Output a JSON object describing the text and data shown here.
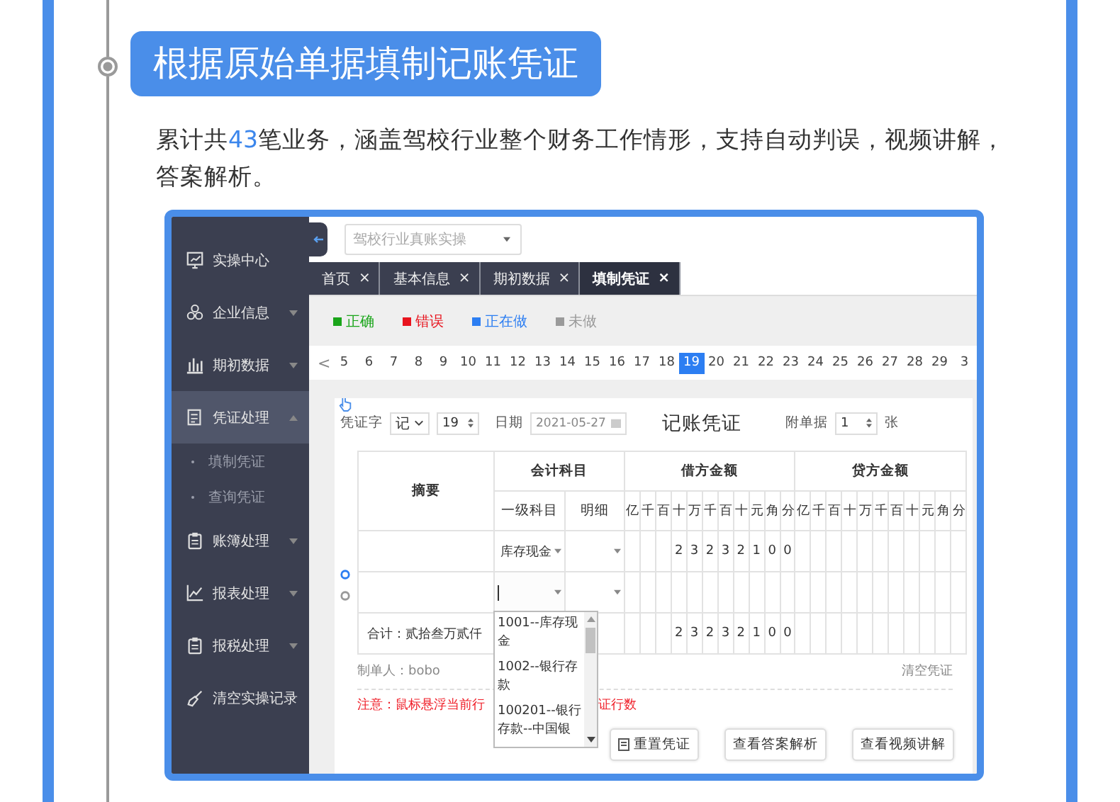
{
  "heading": "根据原始单据填制记账凭证",
  "intro": {
    "before": "累计共",
    "number": "43",
    "after": "笔业务，涵盖驾校行业整个财务工作情形，支持自动判误，视频讲解，答案解析。"
  },
  "app": {
    "sidebar": [
      {
        "label": "实操中心",
        "selected": false
      },
      {
        "label": "企业信息",
        "selected": false,
        "expanded": false
      },
      {
        "label": "期初数据",
        "selected": false,
        "expanded": false
      },
      {
        "label": "凭证处理",
        "selected": true,
        "expanded": true,
        "children": [
          {
            "label": "填制凭证",
            "selected": false
          },
          {
            "label": "查询凭证",
            "selected": false
          }
        ]
      },
      {
        "label": "账簿处理",
        "selected": false,
        "expanded": false
      },
      {
        "label": "报表处理",
        "selected": false,
        "expanded": false
      },
      {
        "label": "报税处理",
        "selected": false,
        "expanded": false
      },
      {
        "label": "清空实操记录",
        "selected": false
      }
    ],
    "company_select": {
      "placeholder": "驾校行业真账实操"
    },
    "tabs": [
      {
        "label": "首页",
        "close": "×",
        "selected": false
      },
      {
        "label": "基本信息",
        "close": "×",
        "selected": false
      },
      {
        "label": "期初数据",
        "close": "×",
        "selected": false
      },
      {
        "label": "填制凭证",
        "close": "×",
        "selected": true
      }
    ],
    "legend": [
      {
        "label": "正确",
        "color": "#1aa51a"
      },
      {
        "label": "错误",
        "color": "#e8141e"
      },
      {
        "label": "正在做",
        "color": "#2c7ef2"
      },
      {
        "label": "未做",
        "color": "#9a9a9a"
      }
    ],
    "pager": {
      "prev": "<",
      "pages": [
        {
          "label": "5",
          "selected": false
        },
        {
          "label": "6",
          "selected": false
        },
        {
          "label": "7",
          "selected": false
        },
        {
          "label": "8",
          "selected": false
        },
        {
          "label": "9",
          "selected": false
        },
        {
          "label": "10",
          "selected": false
        },
        {
          "label": "11",
          "selected": false
        },
        {
          "label": "12",
          "selected": false
        },
        {
          "label": "13",
          "selected": false
        },
        {
          "label": "14",
          "selected": false
        },
        {
          "label": "15",
          "selected": false
        },
        {
          "label": "16",
          "selected": false
        },
        {
          "label": "17",
          "selected": false
        },
        {
          "label": "18",
          "selected": false
        },
        {
          "label": "19",
          "selected": true
        },
        {
          "label": "20",
          "selected": false
        },
        {
          "label": "21",
          "selected": false
        },
        {
          "label": "22",
          "selected": false
        },
        {
          "label": "23",
          "selected": false
        },
        {
          "label": "24",
          "selected": false
        },
        {
          "label": "25",
          "selected": false
        },
        {
          "label": "26",
          "selected": false
        },
        {
          "label": "27",
          "selected": false
        },
        {
          "label": "28",
          "selected": false
        },
        {
          "label": "29",
          "selected": false
        },
        {
          "label": "3",
          "selected": false
        }
      ]
    },
    "voucher": {
      "word_label": "凭证字",
      "word": "记",
      "number": "19",
      "date_label": "日期",
      "date": "2021-05-27",
      "title": "记账凭证",
      "attach_label": "附单据",
      "attach": "1",
      "attach_unit": "张",
      "headers": {
        "summary": "摘要",
        "account": "会计科目",
        "level1": "一级科目",
        "detail": "明细",
        "debit": "借方金额",
        "credit": "贷方金额"
      },
      "debit_units": [
        "亿",
        "千",
        "百",
        "十",
        "万",
        "千",
        "百",
        "十",
        "元",
        "角",
        "分"
      ],
      "credit_units": [
        "亿",
        "千",
        "百",
        "十",
        "万",
        "千",
        "百",
        "十",
        "元",
        "角",
        "分"
      ],
      "rows": [
        {
          "account": "库存现金",
          "debit": [
            "2",
            "3",
            "2",
            "3",
            "2",
            "1",
            "0",
            "0"
          ],
          "editing": false
        },
        {
          "editing": true
        }
      ],
      "total": {
        "label": "合计：贰拾叁万贰仟",
        "debit": [
          "2",
          "3",
          "2",
          "3",
          "2",
          "1",
          "0",
          "0"
        ]
      },
      "maker": "制单人：bobo",
      "clear": "清空凭证",
      "note": [
        "注意：鼠标悬浮当前行",
        "证行数"
      ],
      "dropdown": [
        "1001--库存现金",
        "1002--银行存款",
        "100201--银行存款--中国银"
      ],
      "buttons": [
        "重置凭证",
        "查看答案解析",
        "查看视频讲解"
      ]
    }
  }
}
